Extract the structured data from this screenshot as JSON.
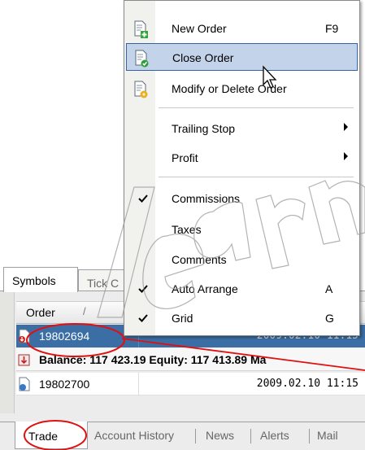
{
  "context_menu": {
    "items": [
      {
        "label": "New Order",
        "shortcut": "F9",
        "icon": "new-order-icon"
      },
      {
        "label": "Close Order",
        "icon": "close-order-icon"
      },
      {
        "label": "Modify or Delete Order",
        "icon": "modify-order-icon"
      },
      {
        "label": "Trailing Stop",
        "submenu": true
      },
      {
        "label": "Profit",
        "submenu": true
      },
      {
        "label": "Commissions",
        "checked": true
      },
      {
        "label": "Taxes",
        "checked": false
      },
      {
        "label": "Comments",
        "checked": false
      },
      {
        "label": "Auto Arrange",
        "shortcut": "A",
        "checked": true
      },
      {
        "label": "Grid",
        "shortcut": "G",
        "checked": true
      }
    ],
    "highlighted": "Close Order"
  },
  "symbols_tabs": {
    "active": "Symbols",
    "inactive": "Tick C"
  },
  "grid": {
    "header_order": "Order",
    "header_sort_glyph": "/"
  },
  "rows": {
    "selected": {
      "order": "19802694",
      "time": "2009.02.10 11:15"
    },
    "balance": "Balance: 117 423.19  Equity: 117 413.89  Ma",
    "second": {
      "order": "19802700",
      "time": "2009.02.10 11:15"
    }
  },
  "bottom_tabs": {
    "active": "Trade",
    "others": [
      "Account History",
      "News",
      "Alerts",
      "Mail"
    ]
  },
  "watermark_text": "learn",
  "colors": {
    "selection": "#3a6ea5",
    "menu_highlight": "#c3d3ea",
    "annotation_red": "#e01010"
  }
}
